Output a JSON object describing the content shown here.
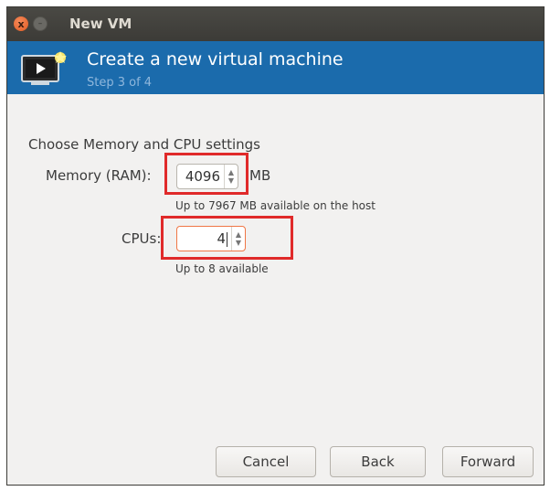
{
  "window": {
    "title": "New VM",
    "close_glyph": "x",
    "minimize_glyph": "–"
  },
  "header": {
    "title": "Create a new virtual machine",
    "step": "Step 3 of 4",
    "icon": "monitor-icon"
  },
  "content": {
    "section_label": "Choose Memory and CPU settings",
    "memory": {
      "label": "Memory (RAM):",
      "value": "4096",
      "unit": "MB",
      "hint": "Up to 7967 MB available on the host"
    },
    "cpus": {
      "label": "CPUs:",
      "value": "4",
      "hint": "Up to 8 available"
    }
  },
  "buttons": {
    "cancel": "Cancel",
    "back": "Back",
    "forward": "Forward"
  },
  "colors": {
    "header_bg": "#1b6bac",
    "titlebar_bg": "#3c3b37",
    "annotation": "#e02a2a",
    "focus": "#f07746"
  }
}
